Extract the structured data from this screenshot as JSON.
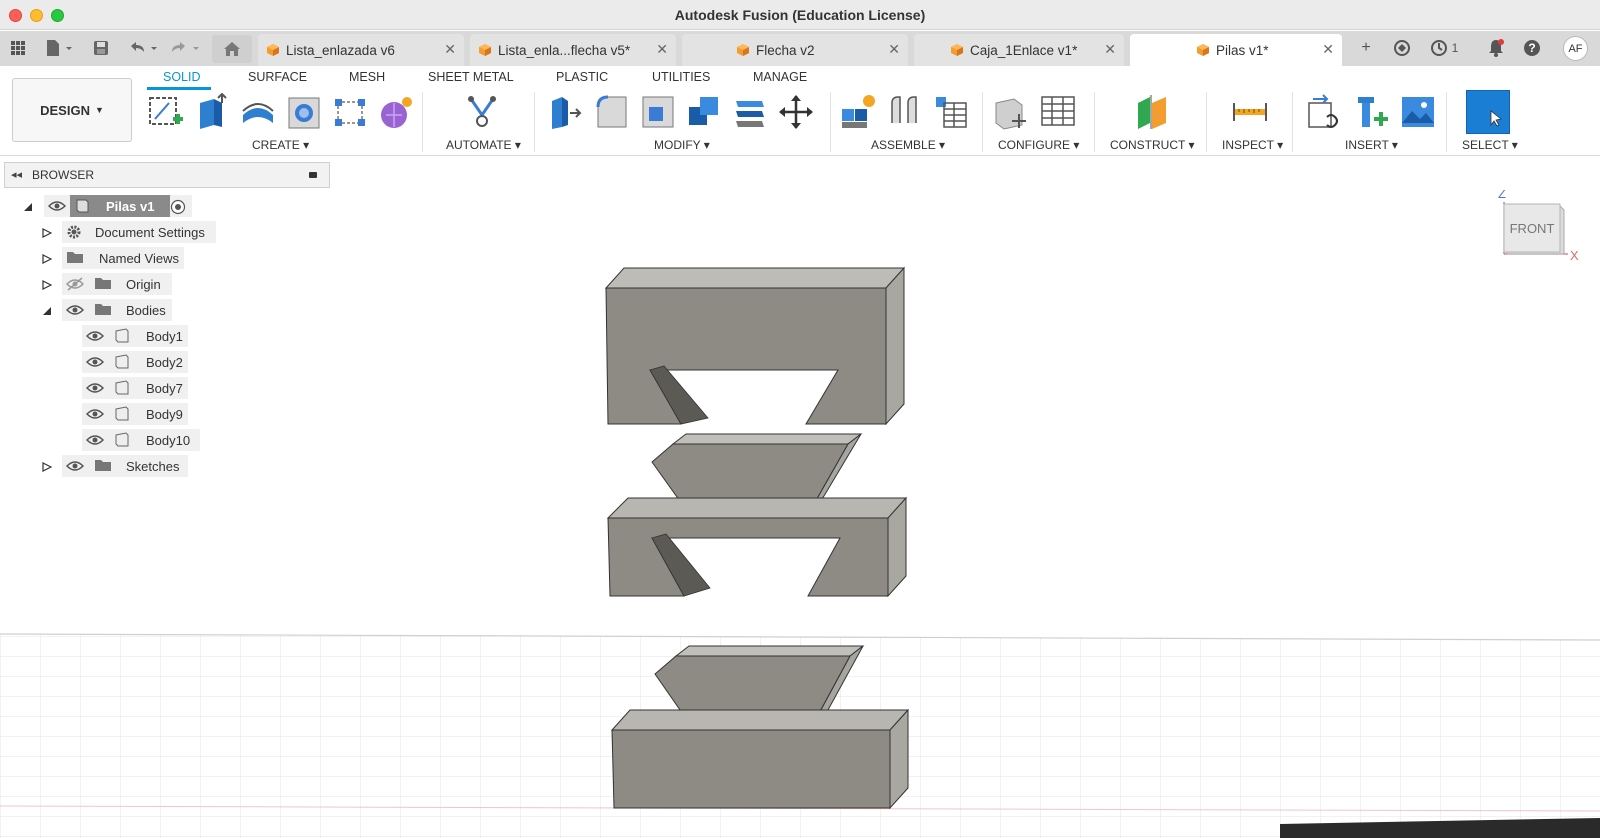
{
  "window": {
    "title": "Autodesk Fusion (Education License)"
  },
  "tabs": [
    {
      "label": "Lista_enlazada v6",
      "active": false
    },
    {
      "label": "Lista_enla...flecha v5*",
      "active": false
    },
    {
      "label": "Flecha v2",
      "active": false
    },
    {
      "label": "Caja_1Enlace v1*",
      "active": false
    },
    {
      "label": "Pilas v1*",
      "active": true
    }
  ],
  "header": {
    "jobs_count": "1",
    "user_initials": "AF"
  },
  "workspace": {
    "label": "DESIGN"
  },
  "ribbon_tabs": [
    "SOLID",
    "SURFACE",
    "MESH",
    "SHEET METAL",
    "PLASTIC",
    "UTILITIES",
    "MANAGE"
  ],
  "ribbon_groups": {
    "create": "CREATE",
    "automate": "AUTOMATE",
    "modify": "MODIFY",
    "assemble": "ASSEMBLE",
    "configure": "CONFIGURE",
    "construct": "CONSTRUCT",
    "inspect": "INSPECT",
    "insert": "INSERT",
    "select": "SELECT"
  },
  "browser": {
    "title": "BROWSER",
    "root": "Pilas v1",
    "items": {
      "document_settings": "Document Settings",
      "named_views": "Named Views",
      "origin": "Origin",
      "bodies": "Bodies",
      "sketches": "Sketches"
    },
    "bodies": [
      "Body1",
      "Body2",
      "Body7",
      "Body9",
      "Body10"
    ]
  },
  "viewcube": {
    "face": "FRONT",
    "axis_z": "Z",
    "axis_x": "X"
  },
  "colors": {
    "accent": "#0696d7",
    "body_face": "#8c8a82",
    "body_top": "#b9b8b2"
  }
}
